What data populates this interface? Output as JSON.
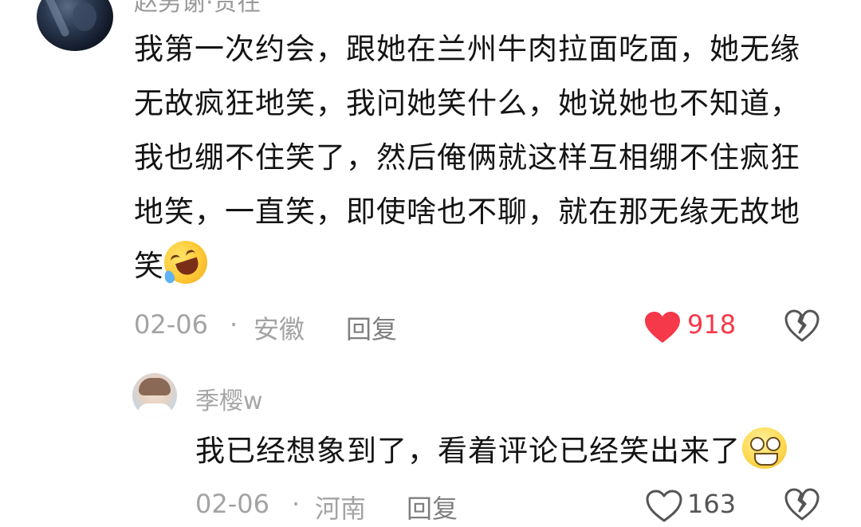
{
  "header_partial": {
    "text": "赵男谢·贵在"
  },
  "comment": {
    "text": "我第一次约会，跟她在兰州牛肉拉面吃面，她无缘无故疯狂地笑，我问她笑什么，她说她也不知道，我也绷不住笑了，然后俺俩就这样互相绷不住疯狂地笑，一直笑，即使啥也不聊，就在那无缘无故地笑",
    "emoji": "rolling-laughing-emoji",
    "date": "02-06",
    "separator": "·",
    "location": "安徽",
    "reply_label": "回复",
    "like_count": "918",
    "like_color": "#f5384a",
    "liked": true
  },
  "reply": {
    "username": "季樱w",
    "text": "我已经想象到了，看着评论已经笑出来了",
    "emoji": "goofy-face-emoji",
    "date": "02-06",
    "separator": "·",
    "location": "河南",
    "reply_label": "回复",
    "like_count": "163",
    "liked": false
  }
}
